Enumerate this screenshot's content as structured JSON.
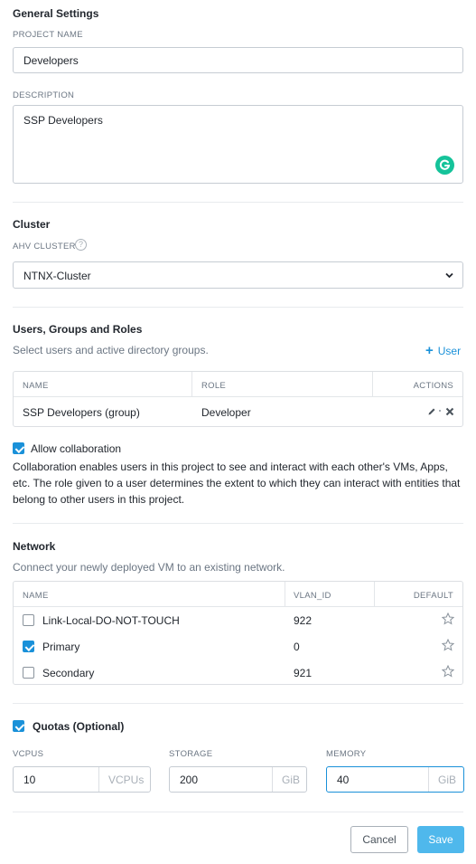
{
  "general": {
    "title": "General Settings",
    "project_name_label": "PROJECT NAME",
    "project_name_value": "Developers",
    "description_label": "DESCRIPTION",
    "description_value": "SSP Developers"
  },
  "cluster": {
    "title": "Cluster",
    "label": "AHV CLUSTER",
    "selected": "NTNX-Cluster"
  },
  "users": {
    "title": "Users, Groups and Roles",
    "subtitle": "Select users and active directory groups.",
    "add_label": "User",
    "columns": [
      "NAME",
      "ROLE",
      "ACTIONS"
    ],
    "rows": [
      {
        "name": "SSP Developers (group)",
        "role": "Developer"
      }
    ],
    "allow_collab_label": "Allow collaboration",
    "allow_collab_checked": true,
    "collab_desc": "Collaboration enables users in this project to see and interact with each other's VMs, Apps, etc. The role given to a user determines the extent to which they can interact with entities that belong to other users in this project."
  },
  "network": {
    "title": "Network",
    "subtitle": "Connect your newly deployed VM to an existing network.",
    "columns": [
      "NAME",
      "VLAN_ID",
      "DEFAULT"
    ],
    "rows": [
      {
        "name": "Link-Local-DO-NOT-TOUCH",
        "vlan": "922",
        "checked": false
      },
      {
        "name": "Primary",
        "vlan": "0",
        "checked": true
      },
      {
        "name": "Secondary",
        "vlan": "921",
        "checked": false
      }
    ]
  },
  "quotas": {
    "label": "Quotas (Optional)",
    "checked": true,
    "vcpus_label": "VCPUS",
    "vcpus_value": "10",
    "vcpus_unit": "VCPUs",
    "storage_label": "STORAGE",
    "storage_value": "200",
    "storage_unit": "GiB",
    "memory_label": "MEMORY",
    "memory_value": "40",
    "memory_unit": "GiB"
  },
  "footer": {
    "cancel_label": "Cancel",
    "save_label": "Save"
  },
  "colors": {
    "accent": "#1a91d9",
    "save_button": "#4fb8ec",
    "grammarly": "#15c39a"
  }
}
